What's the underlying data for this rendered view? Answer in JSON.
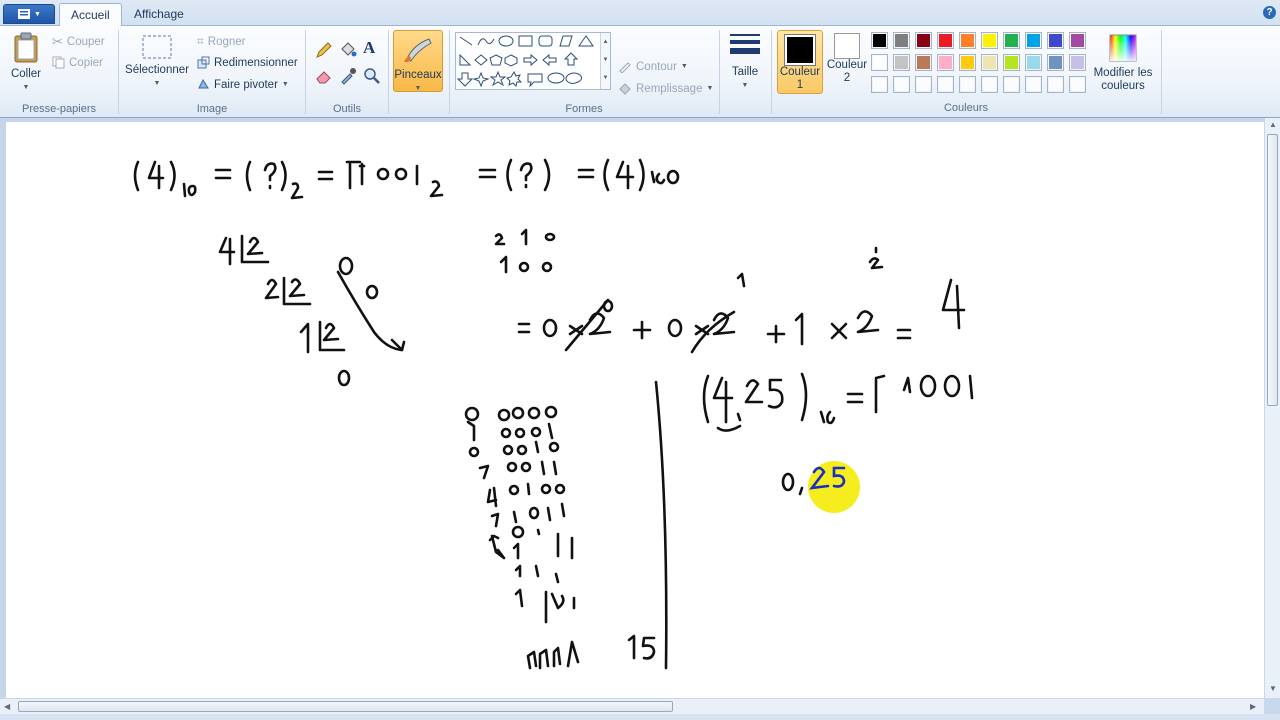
{
  "tabs": {
    "home": "Accueil",
    "view": "Affichage"
  },
  "clipboard": {
    "paste": "Coller",
    "cut": "Couper",
    "copy": "Copier",
    "label": "Presse-papiers"
  },
  "image": {
    "select": "Sélectionner",
    "crop": "Rogner",
    "resize": "Redimensionner",
    "rotate": "Faire pivoter",
    "label": "Image"
  },
  "tools": {
    "label": "Outils"
  },
  "brushes": {
    "label": "Pinceaux"
  },
  "shapes": {
    "outline": "Contour",
    "fill": "Remplissage",
    "label": "Formes"
  },
  "size": {
    "label": "Taille"
  },
  "colors": {
    "color1_label": "Couleur",
    "color1_num": "1",
    "color2_label": "Couleur",
    "color2_num": "2",
    "edit_colors_line1": "Modifier les",
    "edit_colors_line2": "couleurs",
    "label": "Couleurs",
    "color1": "#000000",
    "color2": "#ffffff",
    "palette_row1": [
      "#000000",
      "#7f7f7f",
      "#880015",
      "#ed1c24",
      "#ff7f27",
      "#fff200",
      "#22b14c",
      "#00a2e8",
      "#3f48cc",
      "#a349a4"
    ],
    "palette_row2": [
      "#ffffff",
      "#c3c3c3",
      "#b97a57",
      "#ffaec9",
      "#ffc90e",
      "#efe4b0",
      "#b5e61d",
      "#99d9ea",
      "#7092be",
      "#c8bfe7"
    ],
    "palette_row3_empty": 10
  },
  "canvas": {
    "line1_left": "(4)₁₀ = (?)₂ = 100₂",
    "line1_right": "= (?) = (4)₁₀",
    "division_steps": [
      "4 | 2",
      "2 | 2",
      "1 | 2",
      "0"
    ],
    "remainders": [
      "0",
      "0",
      "1"
    ],
    "powers": "2 1 0",
    "bits": "1 0 0",
    "expansion": "= 0 × 2⁰ + 0 × 2¹ + 1 × 2² = 4",
    "fraction_line": "(4,25)₁₀ = (100,",
    "fraction_work": "0,25",
    "number_15": "15",
    "binary_column": [
      "0",
      "0000",
      "0001",
      "0010",
      "0011",
      "0100",
      "0101",
      "0110",
      "0111",
      "1111"
    ]
  }
}
